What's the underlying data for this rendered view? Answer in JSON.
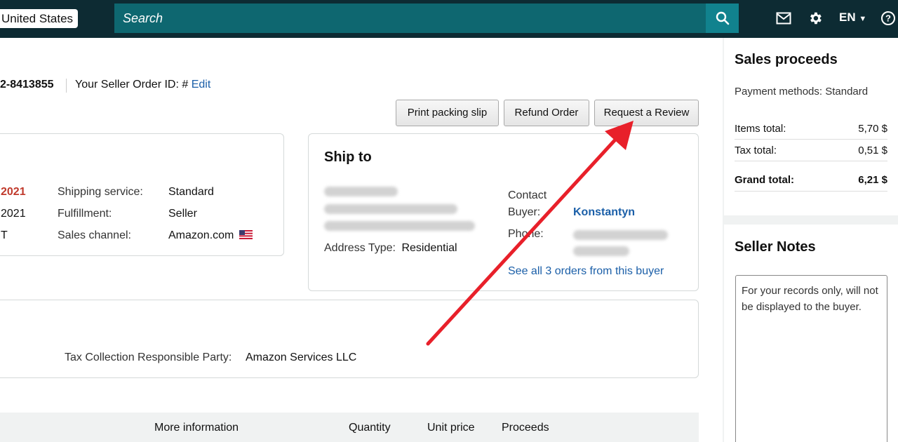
{
  "topbar": {
    "country": "United States",
    "search_placeholder": "Search",
    "language": "EN"
  },
  "order": {
    "order_id_fragment": "2-8413855",
    "seller_order_id_label": "Your Seller Order ID: #",
    "edit_label": "Edit"
  },
  "actions": {
    "print_packing_slip": "Print packing slip",
    "refund_order": "Refund Order",
    "request_review": "Request a Review"
  },
  "order_details": {
    "date_fragment_1": "2021",
    "date_fragment_2": "2021",
    "fragment_3": "T",
    "shipping_service_label": "Shipping service:",
    "shipping_service_value": "Standard",
    "fulfillment_label": "Fulfillment:",
    "fulfillment_value": "Seller",
    "sales_channel_label": "Sales channel:",
    "sales_channel_value": "Amazon.com"
  },
  "ship_to": {
    "title": "Ship to",
    "address_type_label": "Address Type:",
    "address_type_value": "Residential",
    "contact_label": "Contact",
    "buyer_label": "Buyer:",
    "buyer_name": "Konstantyn",
    "phone_label": "Phone:",
    "see_all_orders": "See all 3 orders from this buyer"
  },
  "tax": {
    "label": "Tax Collection Responsible Party:",
    "value": "Amazon Services LLC"
  },
  "table": {
    "headers": [
      "More information",
      "Quantity",
      "Unit price",
      "Proceeds"
    ]
  },
  "sales_proceeds": {
    "title": "Sales proceeds",
    "payment_methods": "Payment methods: Standard",
    "items_total_label": "Items total:",
    "items_total_value": "5,70 $",
    "tax_total_label": "Tax total:",
    "tax_total_value": "0,51 $",
    "grand_total_label": "Grand total:",
    "grand_total_value": "6,21 $"
  },
  "seller_notes": {
    "title": "Seller Notes",
    "placeholder": "For your records only, will not be displayed to the buyer."
  },
  "colors": {
    "topbar": "#0d2b33",
    "search": "#0e6770",
    "link": "#1b5fa8",
    "annotation_arrow": "#e8202a"
  }
}
